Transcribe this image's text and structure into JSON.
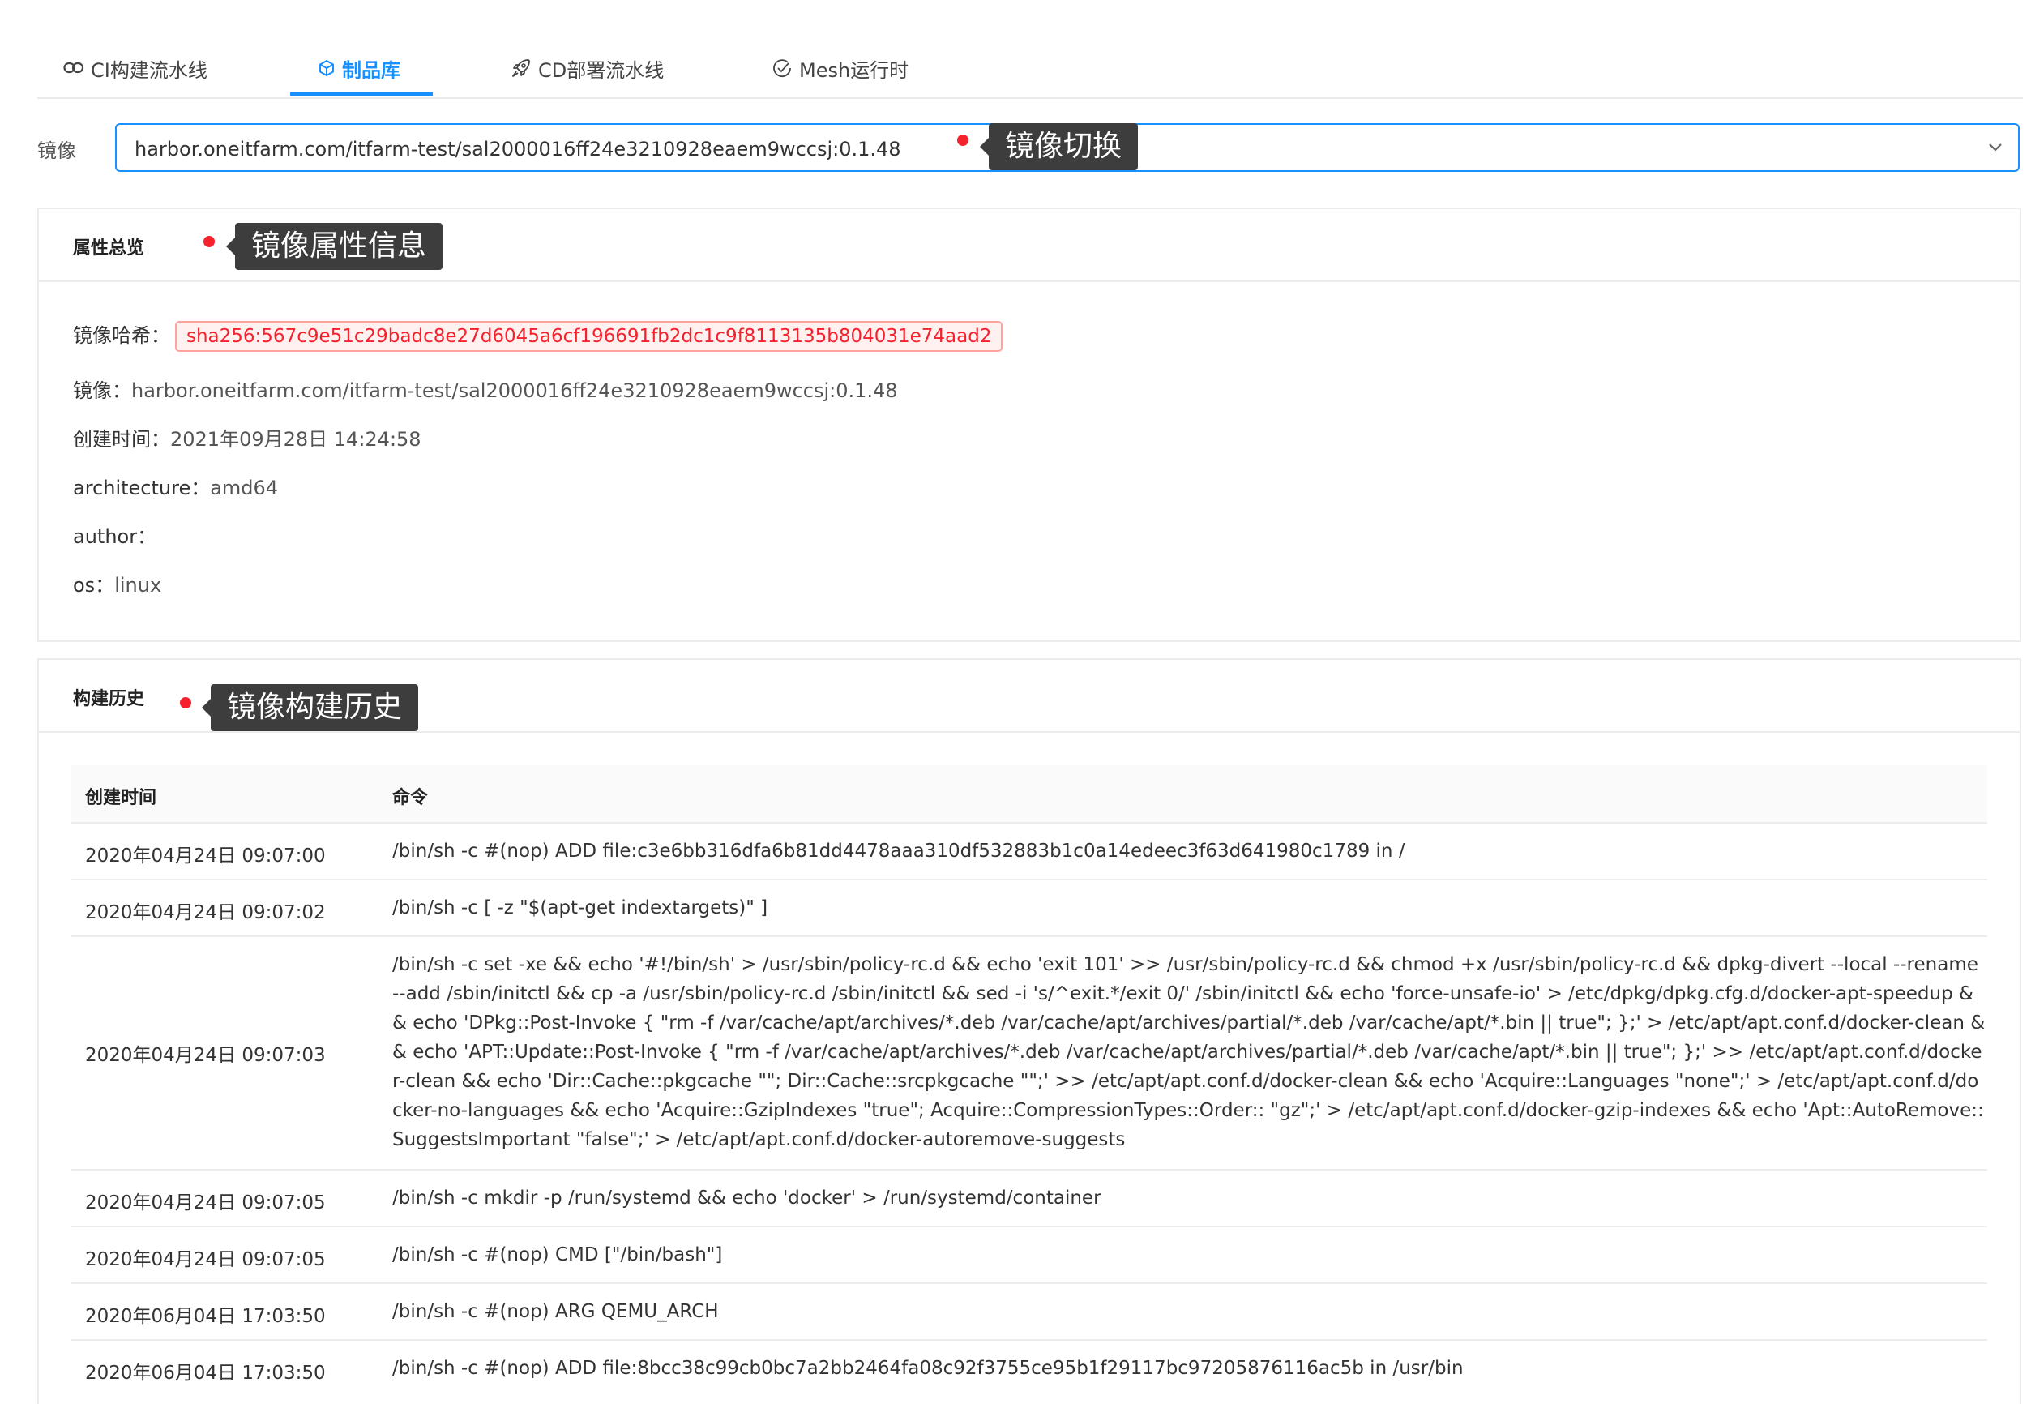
{
  "tabs": [
    {
      "label": "CI构建流水线",
      "icon": "link-icon",
      "active": false
    },
    {
      "label": "制品库",
      "icon": "cube-icon",
      "active": true
    },
    {
      "label": "CD部署流水线",
      "icon": "rocket-icon",
      "active": false
    },
    {
      "label": "Mesh运行时",
      "icon": "check-circle-icon",
      "active": false
    }
  ],
  "image_select": {
    "label": "镜像",
    "value": "harbor.oneitfarm.com/itfarm-test/sal2000016ff24e3210928eaem9wccsj:0.1.48",
    "annotation": "镜像切换"
  },
  "overview": {
    "title": "属性总览",
    "annotation": "镜像属性信息",
    "props": [
      {
        "key": "镜像哈希：",
        "value": "sha256:567c9e51c29badc8e27d6045a6cf196691fb2dc1c9f8113135b804031e74aad2"
      },
      {
        "key": "镜像：",
        "value": "harbor.oneitfarm.com/itfarm-test/sal2000016ff24e3210928eaem9wccsj:0.1.48"
      },
      {
        "key": "创建时间：",
        "value": "2021年09月28日 14:24:58"
      },
      {
        "key": "architecture：",
        "value": "amd64"
      },
      {
        "key": "author：",
        "value": ""
      },
      {
        "key": "os：",
        "value": "linux"
      }
    ]
  },
  "history": {
    "title": "构建历史",
    "annotation": "镜像构建历史",
    "columns": [
      "创建时间",
      "命令"
    ],
    "rows": [
      {
        "time": "2020年04月24日 09:07:00",
        "cmd": "/bin/sh -c #(nop) ADD file:c3e6bb316dfa6b81dd4478aaa310df532883b1c0a14edeec3f63d641980c1789 in /"
      },
      {
        "time": "2020年04月24日 09:07:02",
        "cmd": "/bin/sh -c [ -z \"$(apt-get indextargets)\" ]"
      },
      {
        "time": "2020年04月24日 09:07:03",
        "cmd": "/bin/sh -c set -xe && echo '#!/bin/sh' > /usr/sbin/policy-rc.d && echo 'exit 101' >> /usr/sbin/policy-rc.d && chmod +x /usr/sbin/policy-rc.d && dpkg-divert --local --rename --add /sbin/initctl && cp -a /usr/sbin/policy-rc.d /sbin/initctl && sed -i 's/^exit.*/exit 0/' /sbin/initctl && echo 'force-unsafe-io' > /etc/dpkg/dpkg.cfg.d/docker-apt-speedup && echo 'DPkg::Post-Invoke { \"rm -f /var/cache/apt/archives/*.deb /var/cache/apt/archives/partial/*.deb /var/cache/apt/*.bin || true\"; };' > /etc/apt/apt.conf.d/docker-clean && echo 'APT::Update::Post-Invoke { \"rm -f /var/cache/apt/archives/*.deb /var/cache/apt/archives/partial/*.deb /var/cache/apt/*.bin || true\"; };' >> /etc/apt/apt.conf.d/docker-clean && echo 'Dir::Cache::pkgcache \"\"; Dir::Cache::srcpkgcache \"\";' >> /etc/apt/apt.conf.d/docker-clean && echo 'Acquire::Languages \"none\";' > /etc/apt/apt.conf.d/docker-no-languages && echo 'Acquire::GzipIndexes \"true\"; Acquire::CompressionTypes::Order:: \"gz\";' > /etc/apt/apt.conf.d/docker-gzip-indexes && echo 'Apt::AutoRemove::SuggestsImportant \"false\";' > /etc/apt/apt.conf.d/docker-autoremove-suggests"
      },
      {
        "time": "2020年04月24日 09:07:05",
        "cmd": "/bin/sh -c mkdir -p /run/systemd && echo 'docker' > /run/systemd/container"
      },
      {
        "time": "2020年04月24日 09:07:05",
        "cmd": "/bin/sh -c #(nop) CMD [\"/bin/bash\"]"
      },
      {
        "time": "2020年06月04日 17:03:50",
        "cmd": "/bin/sh -c #(nop) ARG QEMU_ARCH"
      },
      {
        "time": "2020年06月04日 17:03:50",
        "cmd": "/bin/sh -c #(nop) ADD file:8bcc38c99cb0bc7a2bb2464fa08c92f3755ce95b1f29117bc97205876116ac5b in /usr/bin"
      }
    ]
  },
  "colors": {
    "accent": "#1890ff",
    "annotation_dot": "#f5222d",
    "hash_text": "#f5222d",
    "tooltip_bg": "#3d3d3d"
  }
}
